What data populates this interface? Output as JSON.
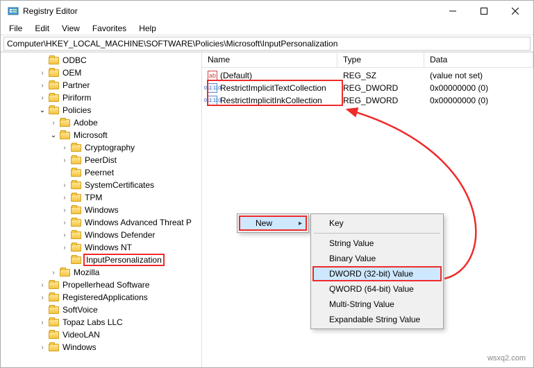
{
  "window": {
    "title": "Registry Editor"
  },
  "menubar": [
    "File",
    "Edit",
    "View",
    "Favorites",
    "Help"
  ],
  "address": "Computer\\HKEY_LOCAL_MACHINE\\SOFTWARE\\Policies\\Microsoft\\InputPersonalization",
  "list": {
    "headers": {
      "name": "Name",
      "type": "Type",
      "data": "Data"
    },
    "rows": [
      {
        "icon": "str",
        "name": "(Default)",
        "type": "REG_SZ",
        "data": "(value not set)"
      },
      {
        "icon": "dw",
        "name": "RestrictImplicitTextCollection",
        "type": "REG_DWORD",
        "data": "0x00000000 (0)"
      },
      {
        "icon": "dw",
        "name": "RestrictImplicitInkCollection",
        "type": "REG_DWORD",
        "data": "0x00000000 (0)"
      }
    ]
  },
  "tree": [
    {
      "depth": 3,
      "chev": "",
      "label": "ODBC"
    },
    {
      "depth": 3,
      "chev": "expR",
      "label": "OEM"
    },
    {
      "depth": 3,
      "chev": "expR",
      "label": "Partner"
    },
    {
      "depth": 3,
      "chev": "expR",
      "label": "Piriform"
    },
    {
      "depth": 3,
      "chev": "expD",
      "label": "Policies"
    },
    {
      "depth": 4,
      "chev": "expR",
      "label": "Adobe"
    },
    {
      "depth": 4,
      "chev": "expD",
      "label": "Microsoft"
    },
    {
      "depth": 5,
      "chev": "expR",
      "label": "Cryptography"
    },
    {
      "depth": 5,
      "chev": "expR",
      "label": "PeerDist"
    },
    {
      "depth": 5,
      "chev": "",
      "label": "Peernet"
    },
    {
      "depth": 5,
      "chev": "expR",
      "label": "SystemCertificates"
    },
    {
      "depth": 5,
      "chev": "expR",
      "label": "TPM"
    },
    {
      "depth": 5,
      "chev": "expR",
      "label": "Windows"
    },
    {
      "depth": 5,
      "chev": "expR",
      "label": "Windows Advanced Threat P"
    },
    {
      "depth": 5,
      "chev": "expR",
      "label": "Windows Defender"
    },
    {
      "depth": 5,
      "chev": "expR",
      "label": "Windows NT"
    },
    {
      "depth": 5,
      "chev": "",
      "label": "InputPersonalization",
      "highlight": true
    },
    {
      "depth": 4,
      "chev": "expR",
      "label": "Mozilla"
    },
    {
      "depth": 3,
      "chev": "expR",
      "label": "Propellerhead Software"
    },
    {
      "depth": 3,
      "chev": "expR",
      "label": "RegisteredApplications"
    },
    {
      "depth": 3,
      "chev": "",
      "label": "SoftVoice"
    },
    {
      "depth": 3,
      "chev": "expR",
      "label": "Topaz Labs LLC"
    },
    {
      "depth": 3,
      "chev": "",
      "label": "VideoLAN"
    },
    {
      "depth": 3,
      "chev": "expR",
      "label": "Windows"
    }
  ],
  "context_menu1": {
    "items": [
      {
        "label": "New",
        "arrow": true,
        "hover": true,
        "redbox": true
      }
    ]
  },
  "context_menu2": {
    "items": [
      {
        "label": "Key"
      },
      {
        "sep": true
      },
      {
        "label": "String Value"
      },
      {
        "label": "Binary Value"
      },
      {
        "label": "DWORD (32-bit) Value",
        "hover": true,
        "redbox": true
      },
      {
        "label": "QWORD (64-bit) Value"
      },
      {
        "label": "Multi-String Value"
      },
      {
        "label": "Expandable String Value"
      }
    ]
  },
  "watermark": "wsxq2.com"
}
